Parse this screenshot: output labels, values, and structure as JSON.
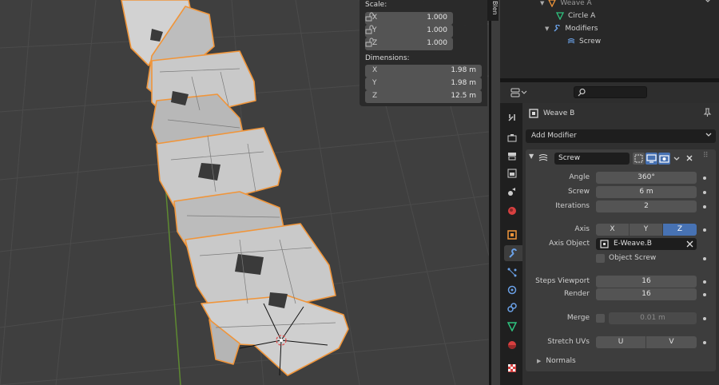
{
  "app": {
    "editor_tab_label": "Blen"
  },
  "n_panel": {
    "scale_heading": "Scale:",
    "scale": [
      {
        "axis": "X",
        "value": "1.000"
      },
      {
        "axis": "Y",
        "value": "1.000"
      },
      {
        "axis": "Z",
        "value": "1.000"
      }
    ],
    "dimensions_heading": "Dimensions:",
    "dimensions": [
      {
        "axis": "X",
        "value": "1.98 m"
      },
      {
        "axis": "Y",
        "value": "1.98 m"
      },
      {
        "axis": "Z",
        "value": "12.5 m"
      }
    ]
  },
  "outliner": {
    "items": [
      {
        "label": "Weave A",
        "icon": "mesh-triangle-icon"
      },
      {
        "label": "Circle A",
        "icon": "mesh-data-icon"
      },
      {
        "label": "Modifiers",
        "icon": "wrench-icon"
      },
      {
        "label": "Screw",
        "icon": "screw-modifier-icon"
      }
    ]
  },
  "properties": {
    "search_placeholder": "",
    "object_name": "Weave B",
    "add_modifier": "Add Modifier",
    "modifier": {
      "name": "Screw",
      "angle_label": "Angle",
      "angle": "360°",
      "screw_label": "Screw",
      "screw": "6 m",
      "iterations_label": "Iterations",
      "iterations": "2",
      "axis_label": "Axis",
      "axis_options": [
        "X",
        "Y",
        "Z"
      ],
      "axis_selected": "Z",
      "axis_object_label": "Axis Object",
      "axis_object": "E-Weave.B",
      "object_screw_label": "Object Screw",
      "steps_viewport_label": "Steps Viewport",
      "steps_viewport": "16",
      "render_label": "Render",
      "render": "16",
      "merge_label": "Merge",
      "merge_distance": "0.01 m",
      "stretch_uvs_label": "Stretch UVs",
      "stretch_u": "U",
      "stretch_v": "V",
      "normals_label": "Normals"
    },
    "tabs": [
      "tool",
      "render",
      "output",
      "view-layer",
      "scene",
      "world",
      "object",
      "modifiers",
      "particles",
      "physics",
      "constraints",
      "data",
      "material",
      "texture"
    ],
    "active_tab": "modifiers"
  },
  "colors": {
    "accent": "#4772b3",
    "selection_orange": "#f0953a",
    "x_axis": "#d84040",
    "y_axis": "#6fa63a"
  }
}
